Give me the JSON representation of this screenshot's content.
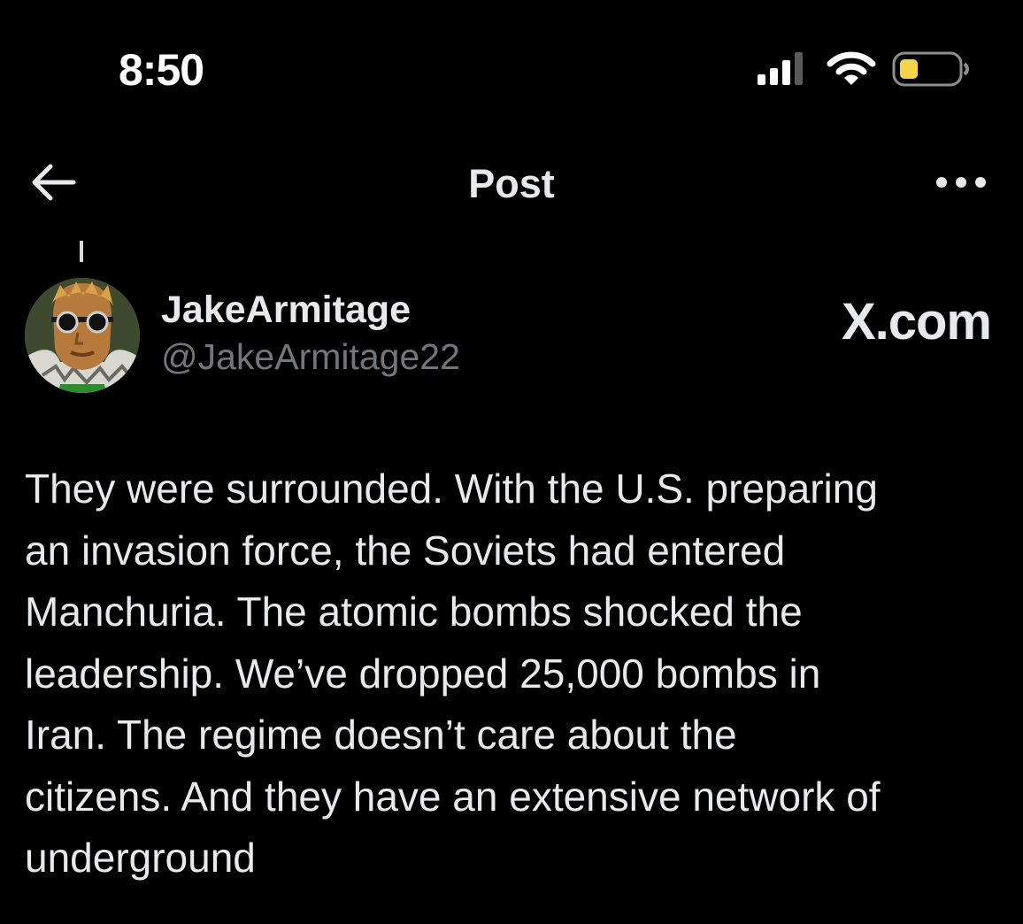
{
  "status_bar": {
    "time": "8:50",
    "signal_icon": "cellular-signal-icon",
    "wifi_icon": "wifi-icon",
    "battery_icon": "battery-low-icon",
    "battery_color": "#f5d547"
  },
  "nav": {
    "back_icon": "arrow-left-icon",
    "title": "Post",
    "more_icon": "more-horizontal-icon"
  },
  "post": {
    "author_name": "JakeArmitage",
    "author_handle": "@JakeArmitage22",
    "avatar_icon": "avatar-image",
    "site_label": "X.com",
    "body": "They were surrounded.  With the U.S. preparing\nan invasion force, the Soviets had entered\nManchuria.  The atomic bombs shocked the\nleadership.  We’ve dropped 25,000 bombs in\nIran.   The regime doesn’t care about the\ncitizens.  And they have an extensive network of\nunderground"
  },
  "colors": {
    "background": "#000000",
    "text_primary": "#e7e9ea",
    "text_secondary": "#71767b"
  }
}
